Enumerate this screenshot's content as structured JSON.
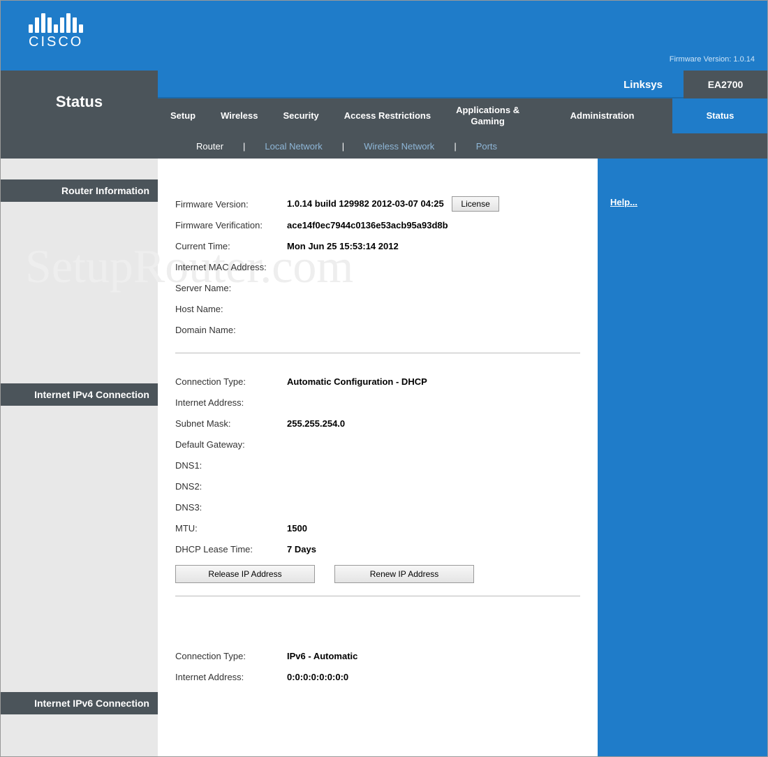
{
  "header": {
    "brand_upper": "CISCO",
    "firmware_label": "Firmware Version: 1.0.14"
  },
  "nav": {
    "page_title": "Status",
    "brand": "Linksys",
    "model": "EA2700",
    "tabs": {
      "setup": "Setup",
      "wireless": "Wireless",
      "security": "Security",
      "access": "Access Restrictions",
      "apps": "Applications &\nGaming",
      "admin": "Administration",
      "status": "Status"
    },
    "subtabs": {
      "router": "Router",
      "local": "Local Network",
      "wireless": "Wireless Network",
      "ports": "Ports"
    }
  },
  "side_headers": {
    "router_info": "Router Information",
    "ipv4": "Internet IPv4 Connection",
    "ipv6": "Internet IPv6 Connection"
  },
  "router_info": {
    "fw_version_label": "Firmware Version:",
    "fw_version_value": "1.0.14 build 129982 2012-03-07 04:25",
    "license_btn": "License",
    "fw_verif_label": "Firmware Verification:",
    "fw_verif_value": "ace14f0ec7944c0136e53acb95a93d8b",
    "current_time_label": "Current Time:",
    "current_time_value": "Mon Jun 25 15:53:14 2012",
    "mac_label": "Internet MAC Address:",
    "mac_value": "",
    "server_label": "Server Name:",
    "server_value": "",
    "host_label": "Host Name:",
    "host_value": "",
    "domain_label": "Domain Name:",
    "domain_value": ""
  },
  "ipv4": {
    "conn_type_label": "Connection Type:",
    "conn_type_value": "Automatic Configuration - DHCP",
    "addr_label": "Internet Address:",
    "addr_value": "",
    "subnet_label": "Subnet Mask:",
    "subnet_value": "255.255.254.0",
    "gateway_label": "Default Gateway:",
    "gateway_value": "",
    "dns1_label": "DNS1:",
    "dns1_value": "",
    "dns2_label": "DNS2:",
    "dns2_value": "",
    "dns3_label": "DNS3:",
    "dns3_value": "",
    "mtu_label": "MTU:",
    "mtu_value": "1500",
    "lease_label": "DHCP Lease Time:",
    "lease_value": "7 Days",
    "release_btn": "Release IP Address",
    "renew_btn": "Renew IP Address"
  },
  "ipv6": {
    "conn_type_label": "Connection Type:",
    "conn_type_value": "IPv6 - Automatic",
    "addr_label": "Internet Address:",
    "addr_value": "0:0:0:0:0:0:0:0"
  },
  "help": {
    "label": "Help..."
  },
  "watermark": "SetupRouter.com"
}
